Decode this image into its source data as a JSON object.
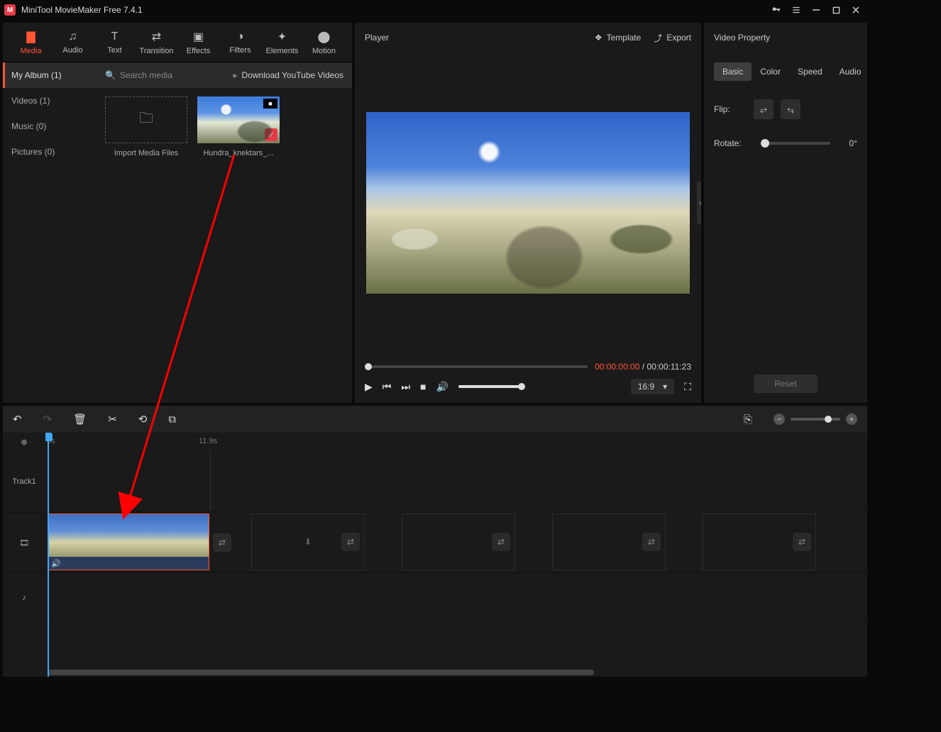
{
  "titlebar": {
    "app_title": "MiniTool MovieMaker Free 7.4.1"
  },
  "media": {
    "tabs": [
      "Media",
      "Audio",
      "Text",
      "Transition",
      "Effects",
      "Filters",
      "Elements",
      "Motion"
    ],
    "sidebar": {
      "album": "My Album (1)",
      "videos": "Videos (1)",
      "music": "Music (0)",
      "pictures": "Pictures (0)"
    },
    "toolbar": {
      "search_placeholder": "Search media",
      "download_label": "Download YouTube Videos"
    },
    "import_label": "Import Media Files",
    "clip_label": "Hundra_knektars_..."
  },
  "player": {
    "title": "Player",
    "template_label": "Template",
    "export_label": "Export",
    "time_current": "00:00:00:00",
    "time_sep": " / ",
    "time_total": "00:00:11:23",
    "aspect": "16:9"
  },
  "property": {
    "title": "Video Property",
    "tabs": {
      "basic": "Basic",
      "color": "Color",
      "speed": "Speed",
      "audio": "Audio"
    },
    "flip_label": "Flip:",
    "rotate_label": "Rotate:",
    "rotate_value": "0°",
    "reset_label": "Reset"
  },
  "timeline": {
    "ruler": {
      "t0": "0s",
      "t1": "11.9s"
    },
    "track1_label": "Track1"
  }
}
